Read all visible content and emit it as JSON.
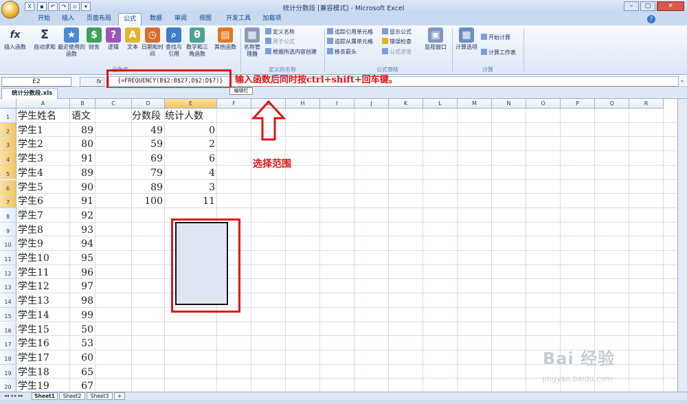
{
  "window": {
    "title": "统计分数段  [兼容模式] - Microsoft Excel"
  },
  "tabs": [
    "开始",
    "插入",
    "页面布局",
    "公式",
    "数据",
    "审阅",
    "视图",
    "开发工具",
    "加载项"
  ],
  "ribbon": {
    "function_library": {
      "buttons": [
        "插入函数",
        "自动求和",
        "最近使用的函数",
        "财务",
        "逻辑",
        "文本",
        "日期和时间",
        "查找与引用",
        "数学和三角函数",
        "其他函数"
      ],
      "label": "函数库"
    },
    "defined_names": {
      "big": "名称管理器",
      "small": [
        "定义名称",
        "用于公式",
        "根据所选内容创建"
      ],
      "label": "定义的名称"
    },
    "formula_auditing": {
      "small": [
        "追踪引用单元格",
        "追踪从属单元格",
        "移去箭头",
        "显示公式",
        "错误检查",
        "公式求值"
      ],
      "big": "监视窗口",
      "label": "公式审核"
    },
    "calculation": {
      "big": "计算选项",
      "small": [
        "开始计算",
        "计算工作表"
      ],
      "label": "计算"
    }
  },
  "formula_bar": {
    "name_box": "E2",
    "fx": "fx",
    "formula": "{=FREQUENCY(B$2:B$27,D$2:D$7)}"
  },
  "tooltip": "编辑栏",
  "annotation_formula": "输入函数后同时按ctrl+shift+回车键。",
  "annotation_range": "选择范围",
  "document_tab": "统计分数段.xls *",
  "columns": [
    "A",
    "B",
    "C",
    "D",
    "E",
    "F",
    "G",
    "H",
    "I",
    "J",
    "K",
    "L",
    "M",
    "N",
    "O",
    "P",
    "Q",
    "R"
  ],
  "rows": [
    "1",
    "2",
    "3",
    "4",
    "5",
    "6",
    "7",
    "8",
    "9",
    "10",
    "11",
    "12",
    "13",
    "14",
    "15",
    "16",
    "17",
    "18",
    "19",
    "20"
  ],
  "sheet": {
    "A": [
      "学生姓名",
      "学生1",
      "学生2",
      "学生3",
      "学生4",
      "学生5",
      "学生6",
      "学生7",
      "学生8",
      "学生9",
      "学生10",
      "学生11",
      "学生12",
      "学生13",
      "学生14",
      "学生15",
      "学生16",
      "学生17",
      "学生18",
      "学生19"
    ],
    "B": [
      "语文",
      "89",
      "80",
      "91",
      "89",
      "90",
      "91",
      "92",
      "93",
      "94",
      "95",
      "96",
      "97",
      "98",
      "99",
      "50",
      "53",
      "60",
      "65",
      "67"
    ],
    "D": [
      "分数段",
      "49",
      "59",
      "69",
      "79",
      "89",
      "100"
    ],
    "E": [
      "统计人数",
      "0",
      "2",
      "6",
      "4",
      "3",
      "11"
    ]
  },
  "sheet_tabs": [
    "Sheet1",
    "Sheet2",
    "Sheet3"
  ],
  "watermark": "Bai 经验",
  "watermark_url": "jingyan.baidu.com"
}
